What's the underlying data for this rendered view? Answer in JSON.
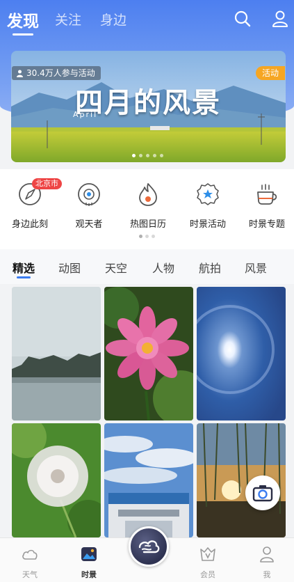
{
  "header": {
    "tabs": [
      {
        "label": "发现",
        "active": true
      },
      {
        "label": "关注",
        "active": false
      },
      {
        "label": "身边",
        "active": false
      }
    ],
    "icons": [
      "search-icon",
      "profile-icon"
    ]
  },
  "banner": {
    "participants": "30.4万人参与活动",
    "badge": "活动",
    "title": "四月的风景",
    "subtitle": "April",
    "slides": 5,
    "active_slide": 1
  },
  "quick_entries": [
    {
      "label": "身边此刻",
      "icon": "compass-icon",
      "badge": "北京市"
    },
    {
      "label": "观天者",
      "icon": "eye-icon"
    },
    {
      "label": "热图日历",
      "icon": "flame-icon"
    },
    {
      "label": "时景活动",
      "icon": "star-badge-icon"
    },
    {
      "label": "时景专题",
      "icon": "cup-icon"
    }
  ],
  "categories": [
    {
      "label": "精选",
      "active": true
    },
    {
      "label": "动图",
      "active": false
    },
    {
      "label": "天空",
      "active": false
    },
    {
      "label": "人物",
      "active": false
    },
    {
      "label": "航拍",
      "active": false
    },
    {
      "label": "风景",
      "active": false
    }
  ],
  "photos": [
    {
      "subject": "lake-mountains-photo"
    },
    {
      "subject": "pink-dahlia-photo"
    },
    {
      "subject": "sun-halo-photo"
    },
    {
      "subject": "dandelion-photo"
    },
    {
      "subject": "station-clouds-photo"
    },
    {
      "subject": "willow-sunset-photo"
    }
  ],
  "bottom_nav": [
    {
      "label": "天气",
      "icon": "cloud-icon",
      "active": false
    },
    {
      "label": "时景",
      "icon": "photo-icon",
      "active": true
    },
    {
      "label": "会员",
      "icon": "vip-icon",
      "active": false
    },
    {
      "label": "我",
      "icon": "person-icon",
      "active": false
    }
  ],
  "colors": {
    "header_blue": "#4d7ff0",
    "accent_blue": "#3b7cf0",
    "badge_orange": "#f6a623",
    "badge_red": "#ee4545"
  }
}
